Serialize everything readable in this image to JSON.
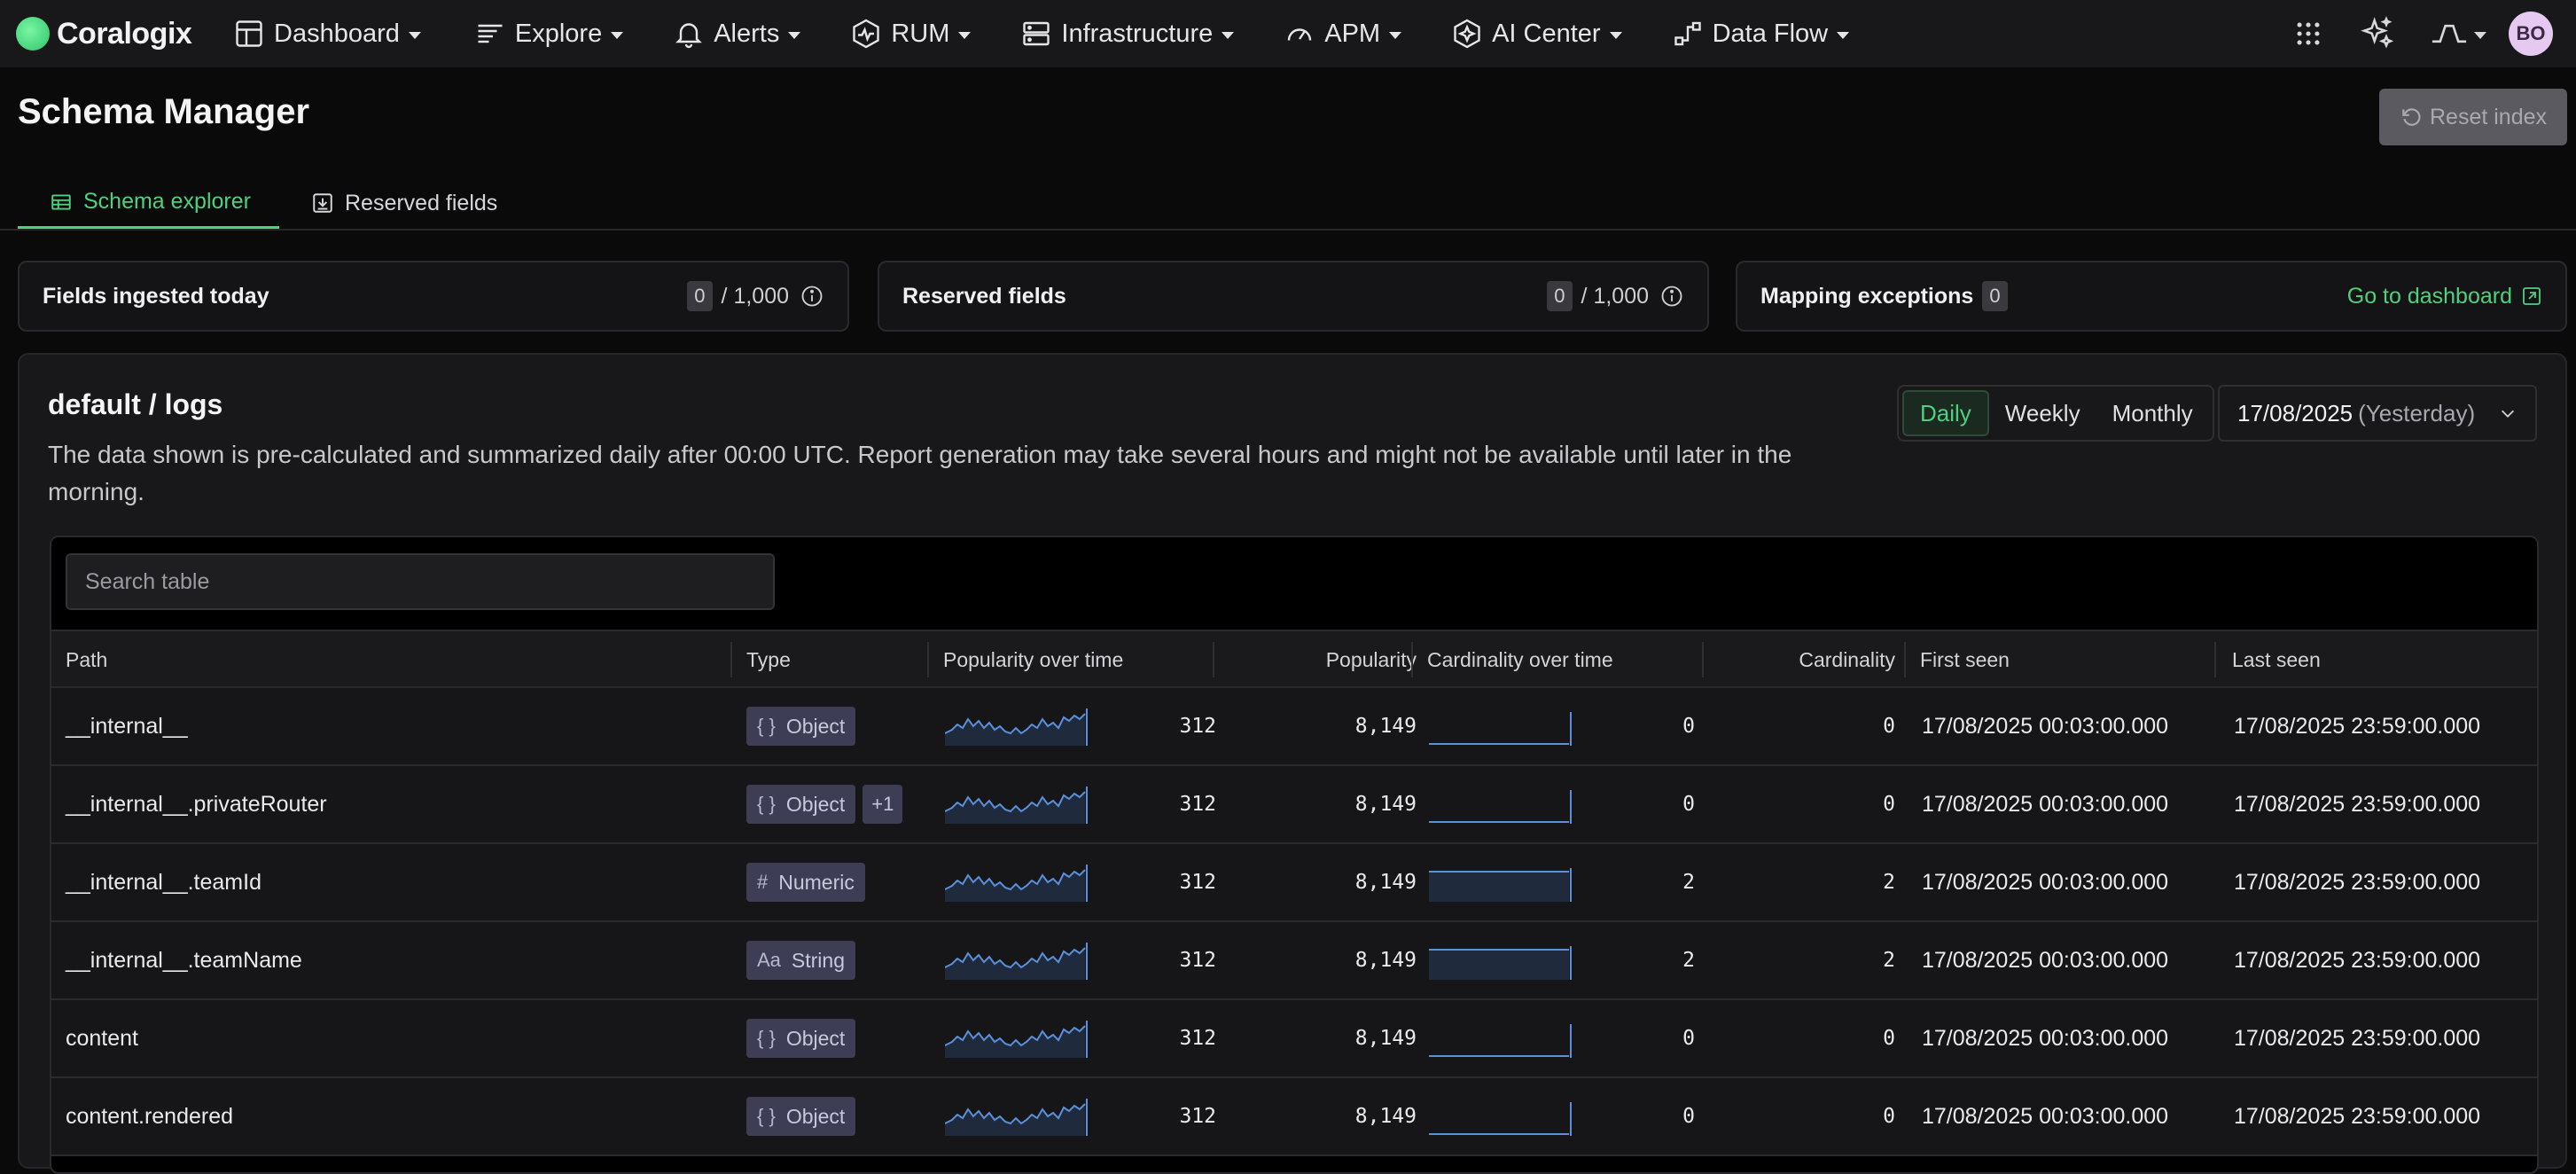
{
  "nav": {
    "brand": "Coralogix",
    "items": [
      {
        "label": "Dashboard",
        "icon": "dashboard-icon"
      },
      {
        "label": "Explore",
        "icon": "explore-icon"
      },
      {
        "label": "Alerts",
        "icon": "bell-icon"
      },
      {
        "label": "RUM",
        "icon": "rum-icon"
      },
      {
        "label": "Infrastructure",
        "icon": "server-icon"
      },
      {
        "label": "APM",
        "icon": "gauge-icon"
      },
      {
        "label": "AI Center",
        "icon": "ai-icon"
      },
      {
        "label": "Data Flow",
        "icon": "flow-icon"
      }
    ],
    "avatar": "BO"
  },
  "page": {
    "title": "Schema Manager",
    "reset_label": "Reset index"
  },
  "tabs": [
    {
      "label": "Schema explorer",
      "active": true
    },
    {
      "label": "Reserved fields",
      "active": false
    }
  ],
  "stats": {
    "ingested": {
      "label": "Fields ingested today",
      "count": "0",
      "limit": "/ 1,000"
    },
    "reserved": {
      "label": "Reserved fields",
      "count": "0",
      "limit": "/ 1,000"
    },
    "exceptions": {
      "label": "Mapping exceptions",
      "count": "0",
      "link": "Go to dashboard"
    }
  },
  "panel": {
    "title": "default / logs",
    "description": "The data shown is pre-calculated and summarized daily after 00:00 UTC. Report generation may take several hours and might not be available until later in the morning.",
    "periods": [
      "Daily",
      "Weekly",
      "Monthly"
    ],
    "active_period": "Daily",
    "date": "17/08/2025",
    "date_note": "(Yesterday)"
  },
  "table": {
    "search_placeholder": "Search table",
    "columns": [
      "Path",
      "Type",
      "Popularity over time",
      "Popularity",
      "Cardinality over time",
      "Cardinality",
      "First seen",
      "Last seen"
    ],
    "rows": [
      {
        "path": "__internal__",
        "type": "Object",
        "type_glyph": "{ }",
        "extra": "",
        "pop_spark": "312",
        "popularity": "8,149",
        "card_spark": "0",
        "cardinality": "0",
        "first_seen": "17/08/2025 00:03:00.000",
        "last_seen": "17/08/2025 23:59:00.000"
      },
      {
        "path": "__internal__.privateRouter",
        "type": "Object",
        "type_glyph": "{ }",
        "extra": "+1",
        "pop_spark": "312",
        "popularity": "8,149",
        "card_spark": "0",
        "cardinality": "0",
        "first_seen": "17/08/2025 00:03:00.000",
        "last_seen": "17/08/2025 23:59:00.000"
      },
      {
        "path": "__internal__.teamId",
        "type": "Numeric",
        "type_glyph": "#",
        "extra": "",
        "pop_spark": "312",
        "popularity": "8,149",
        "card_spark": "2",
        "cardinality": "2",
        "first_seen": "17/08/2025 00:03:00.000",
        "last_seen": "17/08/2025 23:59:00.000"
      },
      {
        "path": "__internal__.teamName",
        "type": "String",
        "type_glyph": "Aa",
        "extra": "",
        "pop_spark": "312",
        "popularity": "8,149",
        "card_spark": "2",
        "cardinality": "2",
        "first_seen": "17/08/2025 00:03:00.000",
        "last_seen": "17/08/2025 23:59:00.000"
      },
      {
        "path": "content",
        "type": "Object",
        "type_glyph": "{ }",
        "extra": "",
        "pop_spark": "312",
        "popularity": "8,149",
        "card_spark": "0",
        "cardinality": "0",
        "first_seen": "17/08/2025 00:03:00.000",
        "last_seen": "17/08/2025 23:59:00.000"
      },
      {
        "path": "content.rendered",
        "type": "Object",
        "type_glyph": "{ }",
        "extra": "",
        "pop_spark": "312",
        "popularity": "8,149",
        "card_spark": "0",
        "cardinality": "0",
        "first_seen": "17/08/2025 00:03:00.000",
        "last_seen": "17/08/2025 23:59:00.000"
      }
    ]
  },
  "colors": {
    "accent": "#4fd07f",
    "spark_line": "#5b8fd9",
    "spark_fill": "#1f2a3d"
  }
}
